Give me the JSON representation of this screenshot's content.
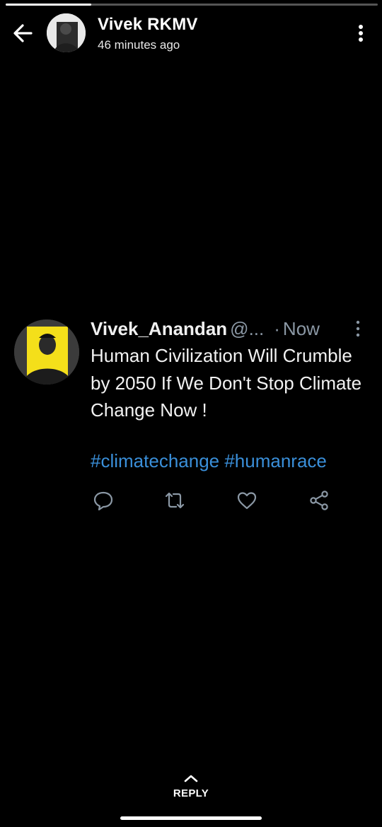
{
  "story": {
    "progress": 0.23,
    "user_name": "Vivek RKMV",
    "time_ago": "46 minutes ago"
  },
  "tweet": {
    "author": "Vivek_Anandan",
    "handle": "@...",
    "separator": "·",
    "time": "Now",
    "text": "Human Civilization Will Crumble by 2050 If We Don't Stop Climate Change Now !",
    "hashtags": "#climatechange #humanrace"
  },
  "reply": {
    "label": "REPLY"
  },
  "colors": {
    "background": "#000000",
    "hashtag": "#3a8fd9",
    "muted": "#8b98a5",
    "avatar_accent": "#f4df1a"
  },
  "icons": [
    "back-arrow-icon",
    "more-vertical-icon",
    "comment-icon",
    "retweet-icon",
    "heart-icon",
    "share-icon",
    "chevron-up-icon"
  ]
}
